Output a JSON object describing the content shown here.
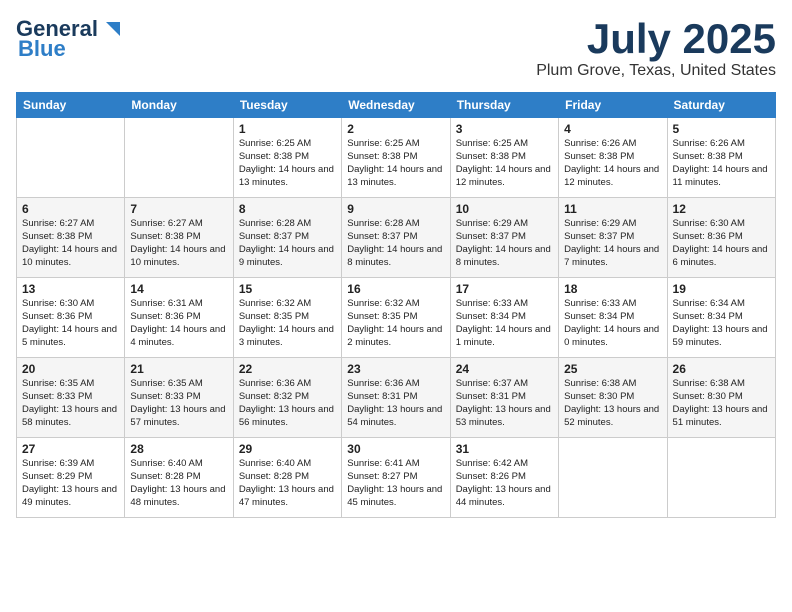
{
  "logo": {
    "line1": "General",
    "line2": "Blue"
  },
  "title": "July 2025",
  "subtitle": "Plum Grove, Texas, United States",
  "days_of_week": [
    "Sunday",
    "Monday",
    "Tuesday",
    "Wednesday",
    "Thursday",
    "Friday",
    "Saturday"
  ],
  "weeks": [
    [
      {
        "day": "",
        "detail": ""
      },
      {
        "day": "",
        "detail": ""
      },
      {
        "day": "1",
        "detail": "Sunrise: 6:25 AM\nSunset: 8:38 PM\nDaylight: 14 hours and 13 minutes."
      },
      {
        "day": "2",
        "detail": "Sunrise: 6:25 AM\nSunset: 8:38 PM\nDaylight: 14 hours and 13 minutes."
      },
      {
        "day": "3",
        "detail": "Sunrise: 6:25 AM\nSunset: 8:38 PM\nDaylight: 14 hours and 12 minutes."
      },
      {
        "day": "4",
        "detail": "Sunrise: 6:26 AM\nSunset: 8:38 PM\nDaylight: 14 hours and 12 minutes."
      },
      {
        "day": "5",
        "detail": "Sunrise: 6:26 AM\nSunset: 8:38 PM\nDaylight: 14 hours and 11 minutes."
      }
    ],
    [
      {
        "day": "6",
        "detail": "Sunrise: 6:27 AM\nSunset: 8:38 PM\nDaylight: 14 hours and 10 minutes."
      },
      {
        "day": "7",
        "detail": "Sunrise: 6:27 AM\nSunset: 8:38 PM\nDaylight: 14 hours and 10 minutes."
      },
      {
        "day": "8",
        "detail": "Sunrise: 6:28 AM\nSunset: 8:37 PM\nDaylight: 14 hours and 9 minutes."
      },
      {
        "day": "9",
        "detail": "Sunrise: 6:28 AM\nSunset: 8:37 PM\nDaylight: 14 hours and 8 minutes."
      },
      {
        "day": "10",
        "detail": "Sunrise: 6:29 AM\nSunset: 8:37 PM\nDaylight: 14 hours and 8 minutes."
      },
      {
        "day": "11",
        "detail": "Sunrise: 6:29 AM\nSunset: 8:37 PM\nDaylight: 14 hours and 7 minutes."
      },
      {
        "day": "12",
        "detail": "Sunrise: 6:30 AM\nSunset: 8:36 PM\nDaylight: 14 hours and 6 minutes."
      }
    ],
    [
      {
        "day": "13",
        "detail": "Sunrise: 6:30 AM\nSunset: 8:36 PM\nDaylight: 14 hours and 5 minutes."
      },
      {
        "day": "14",
        "detail": "Sunrise: 6:31 AM\nSunset: 8:36 PM\nDaylight: 14 hours and 4 minutes."
      },
      {
        "day": "15",
        "detail": "Sunrise: 6:32 AM\nSunset: 8:35 PM\nDaylight: 14 hours and 3 minutes."
      },
      {
        "day": "16",
        "detail": "Sunrise: 6:32 AM\nSunset: 8:35 PM\nDaylight: 14 hours and 2 minutes."
      },
      {
        "day": "17",
        "detail": "Sunrise: 6:33 AM\nSunset: 8:34 PM\nDaylight: 14 hours and 1 minute."
      },
      {
        "day": "18",
        "detail": "Sunrise: 6:33 AM\nSunset: 8:34 PM\nDaylight: 14 hours and 0 minutes."
      },
      {
        "day": "19",
        "detail": "Sunrise: 6:34 AM\nSunset: 8:34 PM\nDaylight: 13 hours and 59 minutes."
      }
    ],
    [
      {
        "day": "20",
        "detail": "Sunrise: 6:35 AM\nSunset: 8:33 PM\nDaylight: 13 hours and 58 minutes."
      },
      {
        "day": "21",
        "detail": "Sunrise: 6:35 AM\nSunset: 8:33 PM\nDaylight: 13 hours and 57 minutes."
      },
      {
        "day": "22",
        "detail": "Sunrise: 6:36 AM\nSunset: 8:32 PM\nDaylight: 13 hours and 56 minutes."
      },
      {
        "day": "23",
        "detail": "Sunrise: 6:36 AM\nSunset: 8:31 PM\nDaylight: 13 hours and 54 minutes."
      },
      {
        "day": "24",
        "detail": "Sunrise: 6:37 AM\nSunset: 8:31 PM\nDaylight: 13 hours and 53 minutes."
      },
      {
        "day": "25",
        "detail": "Sunrise: 6:38 AM\nSunset: 8:30 PM\nDaylight: 13 hours and 52 minutes."
      },
      {
        "day": "26",
        "detail": "Sunrise: 6:38 AM\nSunset: 8:30 PM\nDaylight: 13 hours and 51 minutes."
      }
    ],
    [
      {
        "day": "27",
        "detail": "Sunrise: 6:39 AM\nSunset: 8:29 PM\nDaylight: 13 hours and 49 minutes."
      },
      {
        "day": "28",
        "detail": "Sunrise: 6:40 AM\nSunset: 8:28 PM\nDaylight: 13 hours and 48 minutes."
      },
      {
        "day": "29",
        "detail": "Sunrise: 6:40 AM\nSunset: 8:28 PM\nDaylight: 13 hours and 47 minutes."
      },
      {
        "day": "30",
        "detail": "Sunrise: 6:41 AM\nSunset: 8:27 PM\nDaylight: 13 hours and 45 minutes."
      },
      {
        "day": "31",
        "detail": "Sunrise: 6:42 AM\nSunset: 8:26 PM\nDaylight: 13 hours and 44 minutes."
      },
      {
        "day": "",
        "detail": ""
      },
      {
        "day": "",
        "detail": ""
      }
    ]
  ]
}
